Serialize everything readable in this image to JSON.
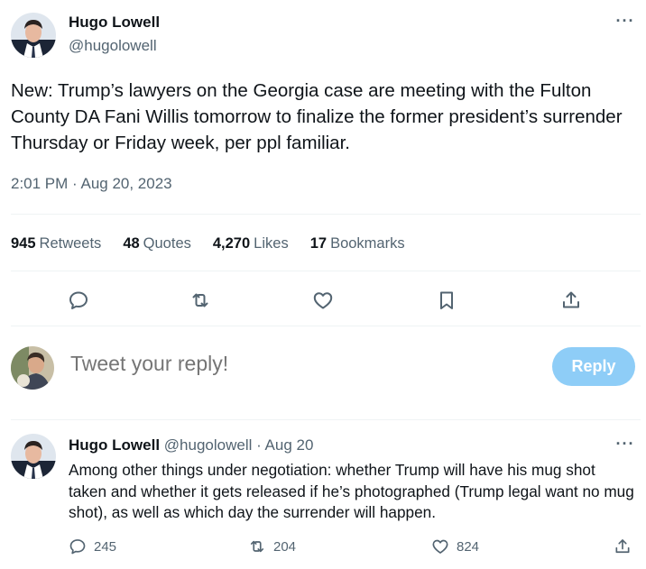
{
  "tweet": {
    "author_name": "Hugo Lowell",
    "author_handle": "@hugolowell",
    "more_icon": "···",
    "text": "New: Trump’s lawyers on the Georgia case are meeting with the Fulton County DA Fani Willis tomorrow to finalize the former president’s surrender Thursday or Friday week, per ppl familiar.",
    "timestamp": "2:01 PM · Aug 20, 2023",
    "stats": {
      "retweets_count": "945",
      "retweets_label": "Retweets",
      "quotes_count": "48",
      "quotes_label": "Quotes",
      "likes_count": "4,270",
      "likes_label": "Likes",
      "bookmarks_count": "17",
      "bookmarks_label": "Bookmarks"
    },
    "actions": [
      "reply-icon",
      "retweet-icon",
      "like-icon",
      "bookmark-icon",
      "share-icon"
    ]
  },
  "compose": {
    "placeholder": "Tweet your reply!",
    "button_label": "Reply",
    "button_color": "#8ecdf7"
  },
  "reply": {
    "author_name": "Hugo Lowell",
    "meta": "@hugolowell · Aug 20",
    "more_icon": "···",
    "text": "Among other things under negotiation: whether Trump will have his mug shot taken and whether it gets released if he’s photographed (Trump legal want no mug shot), as well as which day the surrender will happen.",
    "reply_count": "245",
    "retweet_count": "204",
    "like_count": "824"
  },
  "colors": {
    "text_primary": "#0f1419",
    "text_secondary": "#536471",
    "divider": "#eff3f4"
  }
}
